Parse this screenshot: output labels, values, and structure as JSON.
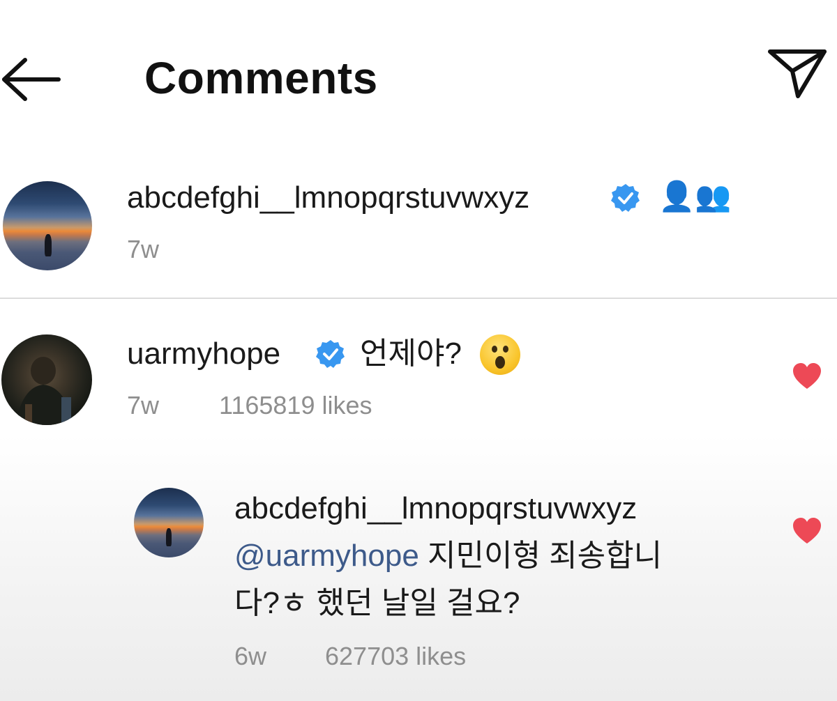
{
  "header": {
    "title": "Comments",
    "back_icon": "arrow-left-icon",
    "share_icon": "paper-plane-icon"
  },
  "caption": {
    "username": "abcdefghi__lmnopqrstuvwxyz",
    "verified": true,
    "emoji": "👤👥",
    "time": "7w"
  },
  "comments": [
    {
      "username": "uarmyhope",
      "verified": true,
      "text": "언제야?",
      "emoji": "😮",
      "time": "7w",
      "likes": "1165819 likes",
      "liked": true,
      "replies": [
        {
          "username": "abcdefghi__lmnopqrstuvwxyz",
          "mention": "@uarmyhope",
          "text_line1": "지민이형 죄송합니",
          "text_line2": "다?ㅎ 했던 날일 걸요?",
          "time": "6w",
          "likes": "627703 likes",
          "liked": true
        }
      ]
    }
  ],
  "colors": {
    "verified_blue": "#3897f0",
    "heart_red": "#ed4956",
    "mention_blue": "#3d5a8a",
    "meta_gray": "#8e8e8e"
  }
}
